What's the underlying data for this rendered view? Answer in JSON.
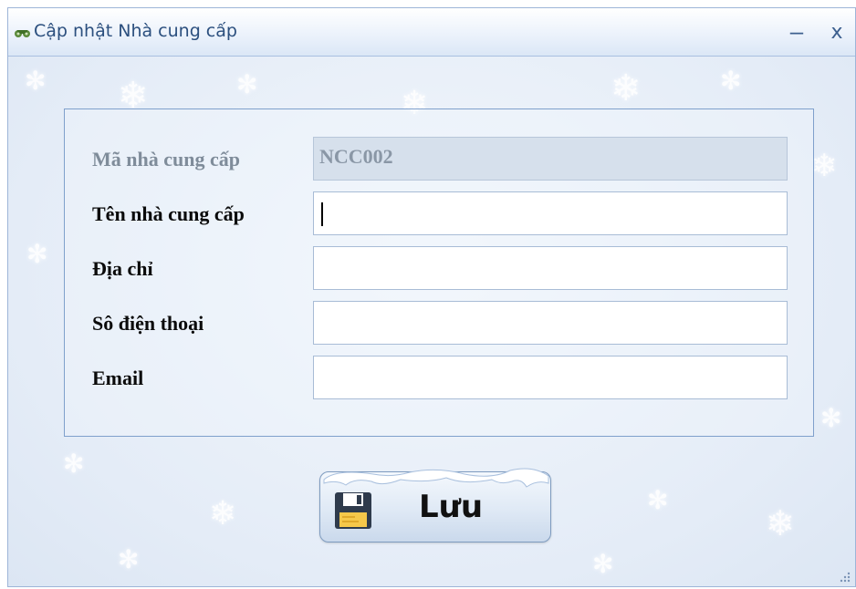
{
  "window": {
    "title": "Cập nhật Nhà cung cấp",
    "minimize_glyph": "–",
    "close_glyph": "x"
  },
  "form": {
    "fields": [
      {
        "label": "Mã nhà cung cấp",
        "value": "NCC002",
        "disabled": true
      },
      {
        "label": "Tên nhà cung cấp",
        "value": "",
        "disabled": false,
        "focused": true
      },
      {
        "label": "Địa chỉ",
        "value": "",
        "disabled": false
      },
      {
        "label": "Sô điện thoại",
        "value": "",
        "disabled": false
      },
      {
        "label": "Email",
        "value": "",
        "disabled": false
      }
    ]
  },
  "actions": {
    "save_label": "Lưu",
    "save_icon": "floppy-disk-icon"
  },
  "colors": {
    "title_text": "#2b4f7e",
    "group_border": "#7fa0cc",
    "disabled_field_bg": "#d6e0ec"
  }
}
